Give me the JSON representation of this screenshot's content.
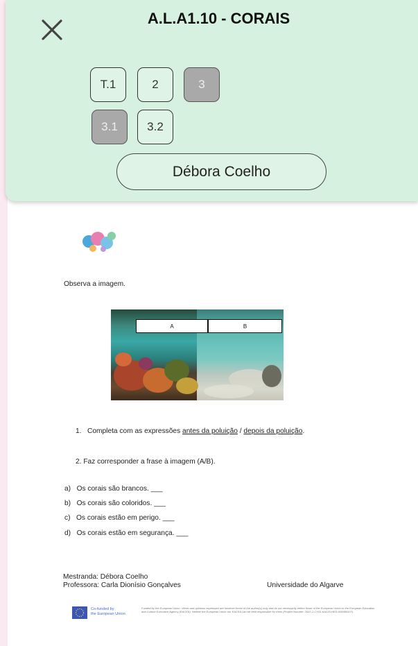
{
  "header": {
    "title": "A.L.A1.10 - CORAIS",
    "tabs": [
      {
        "label": "T.1",
        "state": "active"
      },
      {
        "label": "2",
        "state": "active"
      },
      {
        "label": "3",
        "state": "disabled"
      },
      {
        "label": "3.1",
        "state": "disabled"
      },
      {
        "label": "3.2",
        "state": "active"
      }
    ],
    "student_name": "Débora Coelho"
  },
  "document": {
    "intro": "Observa a imagem.",
    "image_labels": {
      "a": "A",
      "b": "B"
    },
    "q1_number": "1.",
    "q1_prefix": "Completa com as expressões ",
    "q1_phrase1": "antes da poluição",
    "q1_sep": " / ",
    "q1_phrase2": "depois da poluição",
    "q1_end": ".",
    "q2": "2.   Faz corresponder a frase à imagem (A/B).",
    "items": [
      {
        "letter": "a)",
        "text": "Os corais são brancos. ___"
      },
      {
        "letter": "b)",
        "text": "Os corais são coloridos. ___"
      },
      {
        "letter": "c)",
        "text": "Os corais estão em perigo. ___"
      },
      {
        "letter": "d)",
        "text": "Os corais estão em segurança. ___"
      }
    ],
    "mestranda": "Mestranda: Débora Coelho",
    "professora": "Professora: Carla Dionísio Gonçalves",
    "university": "Universidade do Algarve",
    "eu_line1": "Co-funded by",
    "eu_line2": "the European Union",
    "disclaimer": "Funded by the European Union. Views and opinions expressed are however those of the author(s) only and do not necessarily reflect those of the European Union or the European Education and Culture Executive Agency (EACEA). Neither the European Union nor EACEA can be held responsible for them (Project Number: 2022-1-CY01-KA220-HED-000086107)."
  },
  "colors": {
    "header_bg": "#d7f1e0",
    "tab_disabled": "#a9a9a9",
    "eu_blue": "#3a57b7"
  }
}
